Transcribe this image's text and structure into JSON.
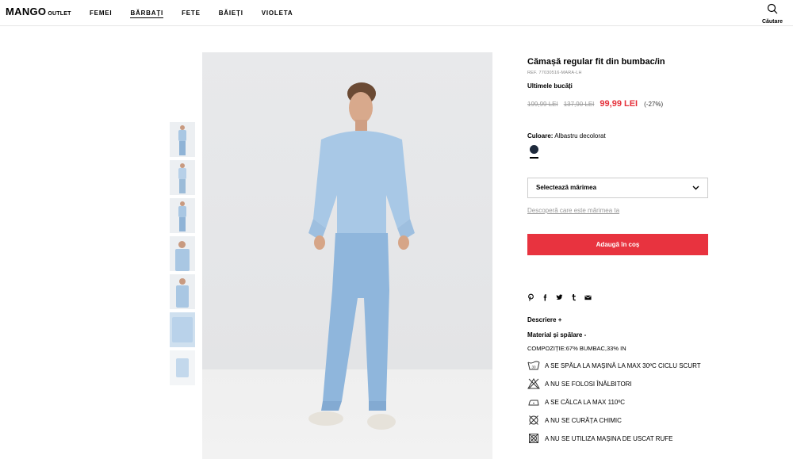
{
  "brand": {
    "logo": "MANGO",
    "sub": "OUTLET"
  },
  "nav": {
    "items": [
      "FEMEI",
      "BĂRBAȚI",
      "FETE",
      "BĂIEȚI",
      "VIOLETA"
    ],
    "active_index": 1
  },
  "search": {
    "label": "Căutare",
    "icon": "search-icon"
  },
  "product": {
    "title": "Cămașă regular fit din bumbac/in",
    "ref": "REF. 77030516-MARA-LH",
    "stock": "Ultimele bucăți",
    "price_original": "199,99 LEI",
    "price_previous": "137,90 LEI",
    "price_current": "99,99 LEI",
    "discount": "(-27%)",
    "color_label": "Culoare:",
    "color_value": "Albastru decolorat",
    "swatch_color": "#1e2a3c",
    "size_select": "Selectează mărimea",
    "size_guide": "Descoperă care este mărimea ta",
    "add_button": "Adaugă în coș"
  },
  "share": [
    "pinterest-icon",
    "facebook-icon",
    "twitter-icon",
    "tumblr-icon",
    "mail-icon"
  ],
  "sections": {
    "description": "Descriere +",
    "material": "Material și spălare -"
  },
  "composition": "COMPOZIȚIE:67% BUMBAC,33% IN",
  "care": [
    {
      "icon": "wash-30-icon",
      "text": "A SE SPĂLA LA MAȘINĂ LA MAX 30ºC CICLU SCURT"
    },
    {
      "icon": "no-bleach-icon",
      "text": "A NU SE FOLOSI ÎNĂLBITORI"
    },
    {
      "icon": "iron-110-icon",
      "text": "A SE CĂLCA LA MAX 110ºC"
    },
    {
      "icon": "no-dry-clean-icon",
      "text": "A NU SE CURĂȚA CHIMIC"
    },
    {
      "icon": "no-tumble-dry-icon",
      "text": "A NU SE UTILIZA MAȘINA DE USCAT RUFE"
    }
  ],
  "colors": {
    "accent": "#e8333f",
    "price_sale": "#e5323c"
  }
}
